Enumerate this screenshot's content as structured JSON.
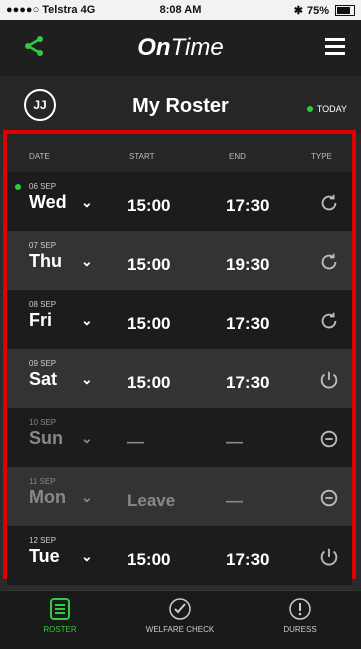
{
  "status_bar": {
    "carrier": "●●●●○ Telstra",
    "network": "4G",
    "time": "8:08 AM",
    "battery": "75%"
  },
  "header": {
    "logo_prefix": "On",
    "logo_suffix": "Time"
  },
  "title_bar": {
    "avatar_initials": "JJ",
    "title": "My Roster",
    "today_label": "TODAY"
  },
  "columns": {
    "date": "DATE",
    "start": "START",
    "end": "END",
    "type": "TYPE"
  },
  "rows": [
    {
      "date": "06 SEP",
      "day": "Wed",
      "start": "15:00",
      "end": "17:30",
      "type": "refresh-icon",
      "today": true,
      "off": false
    },
    {
      "date": "07 SEP",
      "day": "Thu",
      "start": "15:00",
      "end": "19:30",
      "type": "refresh-icon",
      "today": false,
      "off": false
    },
    {
      "date": "08 SEP",
      "day": "Fri",
      "start": "15:00",
      "end": "17:30",
      "type": "refresh-icon",
      "today": false,
      "off": false
    },
    {
      "date": "09 SEP",
      "day": "Sat",
      "start": "15:00",
      "end": "17:30",
      "type": "power-icon",
      "today": false,
      "off": false
    },
    {
      "date": "10 SEP",
      "day": "Sun",
      "start": "—",
      "end": "—",
      "type": "minus-circle-icon",
      "today": false,
      "off": true
    },
    {
      "date": "11 SEP",
      "day": "Mon",
      "start": "Leave",
      "end": "—",
      "type": "minus-circle-icon",
      "today": false,
      "off": true
    },
    {
      "date": "12 SEP",
      "day": "Tue",
      "start": "15:00",
      "end": "17:30",
      "type": "power-icon",
      "today": false,
      "off": false
    }
  ],
  "bottom_nav": [
    {
      "label": "ROSTER",
      "icon": "roster-icon",
      "active": true
    },
    {
      "label": "WELFARE CHECK",
      "icon": "check-circle-icon",
      "active": false
    },
    {
      "label": "DURESS",
      "icon": "alert-circle-icon",
      "active": false
    }
  ],
  "colors": {
    "accent": "#2ecc40",
    "highlight_border": "#e00000"
  }
}
